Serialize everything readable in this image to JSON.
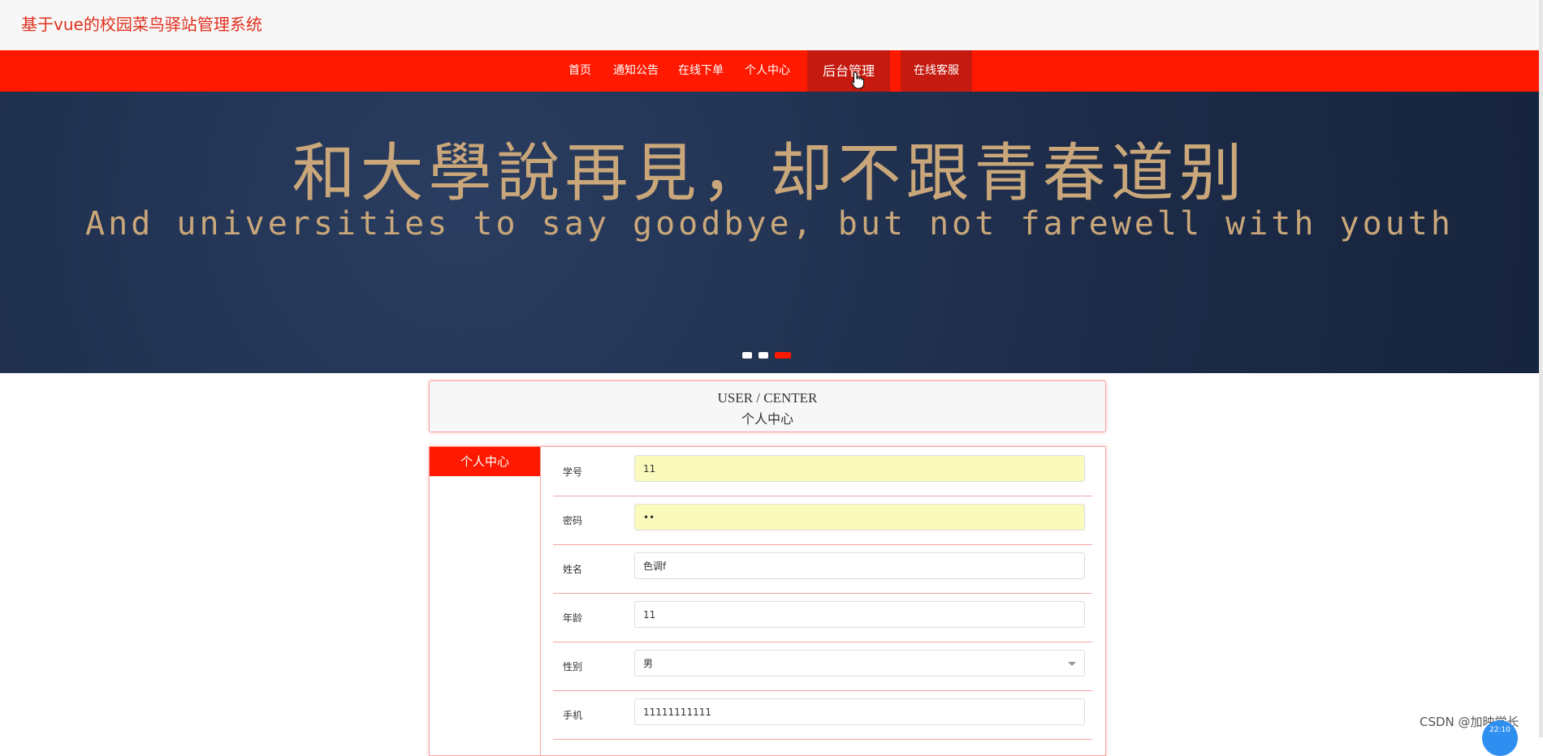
{
  "site": {
    "title": "基于vue的校园菜鸟驿站管理系统"
  },
  "nav": {
    "items": [
      {
        "label": "首页"
      },
      {
        "label": "通知公告"
      },
      {
        "label": "在线下单"
      },
      {
        "label": "个人中心"
      },
      {
        "label": "后台管理"
      },
      {
        "label": "在线客服"
      }
    ]
  },
  "banner": {
    "headline_cn": "和大學說再見，却不跟青春道别",
    "headline_en": "And universities to say goodbye, but not farewell with youth",
    "slide_count": 3,
    "active_slide": 3
  },
  "user_center": {
    "title_en": "USER / CENTER",
    "title_cn": "个人中心"
  },
  "sidebar": {
    "active_tab": "个人中心"
  },
  "form": {
    "fields": [
      {
        "label": "学号",
        "value": "11",
        "autofilled": true
      },
      {
        "label": "密码",
        "value": "••",
        "autofilled": true
      },
      {
        "label": "姓名",
        "value": "色调f"
      },
      {
        "label": "年龄",
        "value": "11"
      },
      {
        "label": "性别",
        "value": "男",
        "type": "select"
      },
      {
        "label": "手机",
        "value": "11111111111"
      }
    ]
  },
  "watermark": "CSDN @加映学长",
  "float_badge": "22:10",
  "colors": {
    "brand_red": "#ff1900",
    "nav_active": "#c41a0f",
    "banner_bg": "#1e2f4e",
    "title_red": "#e0301e",
    "autofill": "#fafabd"
  }
}
